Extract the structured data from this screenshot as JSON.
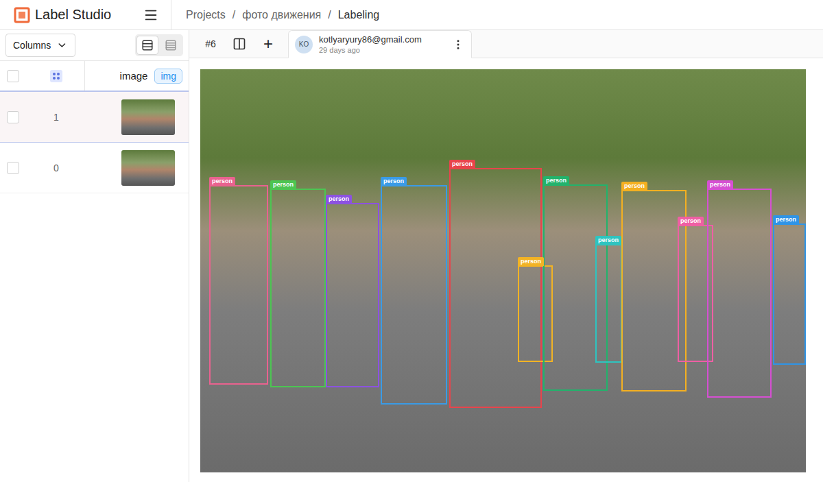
{
  "app": {
    "name": "Label Studio"
  },
  "breadcrumbs": {
    "separator": "/",
    "items": [
      "Projects",
      "фото движения",
      "Labeling"
    ]
  },
  "left_panel": {
    "columns_button": "Columns",
    "view_modes": [
      {
        "name": "list",
        "selected": true
      },
      {
        "name": "grid",
        "selected": false
      }
    ],
    "table": {
      "select_all": {
        "checked": false
      },
      "columns": [
        {
          "label": "image",
          "badge": "img"
        }
      ],
      "rows": [
        {
          "id": "1",
          "selected": true,
          "checked": false
        },
        {
          "id": "0",
          "selected": false,
          "checked": false
        }
      ]
    }
  },
  "task": {
    "id": "#6",
    "add": "+",
    "annotation": {
      "avatar": "KO",
      "user": "kotlyaryury86@gmail.com",
      "time": "29 days ago",
      "selected": true
    }
  },
  "regions": [
    {
      "label": "person",
      "color": "#e9628f"
    },
    {
      "label": "person",
      "color": "#4cc552"
    },
    {
      "label": "person",
      "color": "#8c52e0"
    },
    {
      "label": "person",
      "color": "#3a9be6"
    },
    {
      "label": "person",
      "color": "#e8444c"
    },
    {
      "label": "person",
      "color": "#f2b324"
    },
    {
      "label": "person",
      "color": "#22b36c"
    },
    {
      "label": "person",
      "color": "#2ec4c0"
    },
    {
      "label": "person",
      "color": "#f4b021"
    },
    {
      "label": "person",
      "color": "#ef5fa4"
    },
    {
      "label": "person",
      "color": "#d64fd3"
    },
    {
      "label": "person",
      "color": "#2f94e6"
    }
  ]
}
